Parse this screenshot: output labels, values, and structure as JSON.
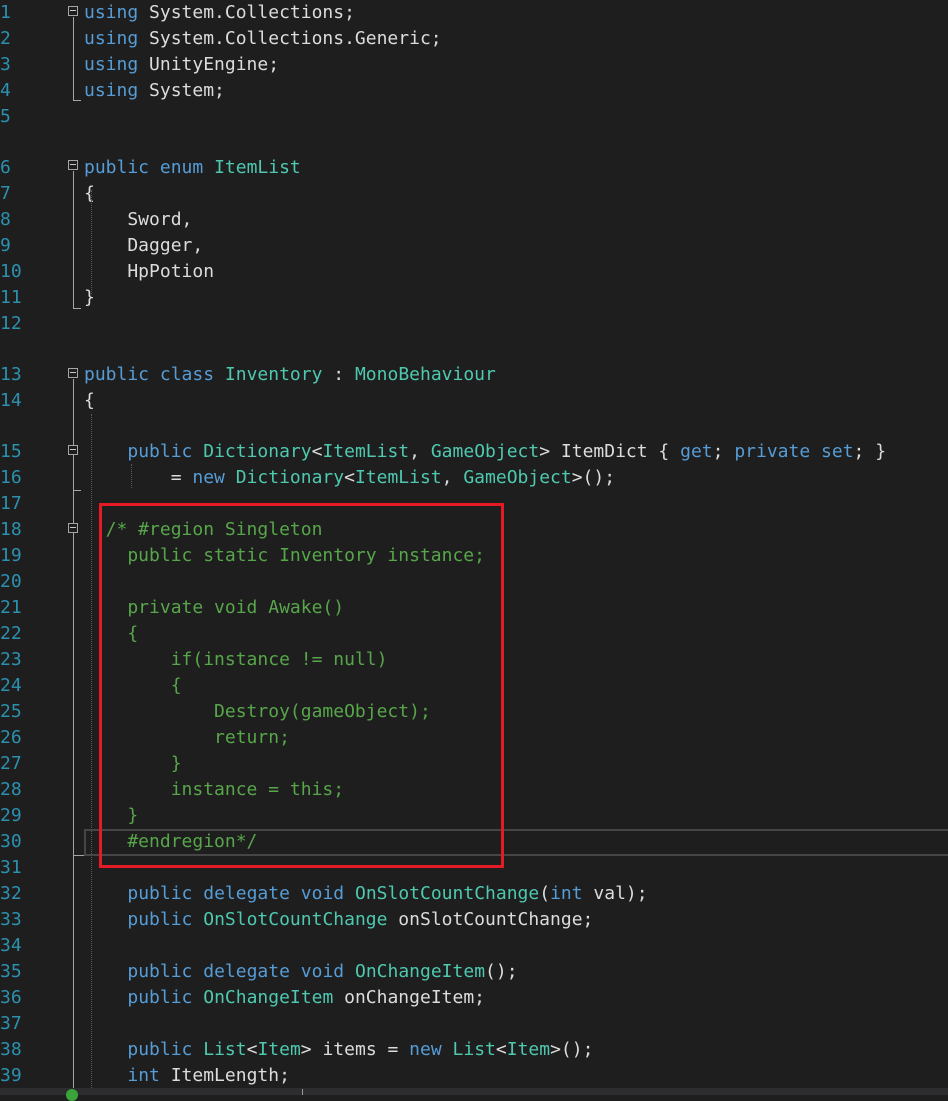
{
  "editor": {
    "line_numbers": [
      "1",
      "2",
      "3",
      "4",
      "5",
      "6",
      "7",
      "8",
      "9",
      "10",
      "11",
      "12",
      "13",
      "14",
      "15",
      "16",
      "17",
      "18",
      "19",
      "20",
      "21",
      "22",
      "23",
      "24",
      "25",
      "26",
      "27",
      "28",
      "29",
      "30",
      "31",
      "32",
      "33",
      "34",
      "35",
      "36",
      "37",
      "38",
      "39"
    ],
    "lines": {
      "l1": [
        {
          "t": "using",
          "c": "kw"
        },
        {
          "t": " System.Collections;",
          "c": "tx"
        }
      ],
      "l2": [
        {
          "t": "using",
          "c": "kw"
        },
        {
          "t": " System.Collections.Generic;",
          "c": "tx"
        }
      ],
      "l3": [
        {
          "t": "using",
          "c": "kw"
        },
        {
          "t": " UnityEngine;",
          "c": "tx"
        }
      ],
      "l4": [
        {
          "t": "using",
          "c": "kw"
        },
        {
          "t": " System;",
          "c": "tx"
        }
      ],
      "l6": [
        {
          "t": "public",
          "c": "kw"
        },
        {
          "t": " ",
          "c": "tx"
        },
        {
          "t": "enum",
          "c": "kw"
        },
        {
          "t": " ",
          "c": "tx"
        },
        {
          "t": "ItemList",
          "c": "ty"
        }
      ],
      "l7": [
        {
          "t": "{",
          "c": "tx"
        }
      ],
      "l8": [
        {
          "t": "    Sword,",
          "c": "tx"
        }
      ],
      "l9": [
        {
          "t": "    Dagger,",
          "c": "tx"
        }
      ],
      "l10": [
        {
          "t": "    HpPotion",
          "c": "tx"
        }
      ],
      "l11": [
        {
          "t": "}",
          "c": "tx"
        }
      ],
      "l13": [
        {
          "t": "public",
          "c": "kw"
        },
        {
          "t": " ",
          "c": "tx"
        },
        {
          "t": "class",
          "c": "kw"
        },
        {
          "t": " ",
          "c": "tx"
        },
        {
          "t": "Inventory",
          "c": "ty"
        },
        {
          "t": " : ",
          "c": "tx"
        },
        {
          "t": "MonoBehaviour",
          "c": "ty"
        }
      ],
      "l14": [
        {
          "t": "{",
          "c": "tx"
        }
      ],
      "l15": [
        {
          "t": "    ",
          "c": "tx"
        },
        {
          "t": "public",
          "c": "kw"
        },
        {
          "t": " ",
          "c": "tx"
        },
        {
          "t": "Dictionary",
          "c": "ty"
        },
        {
          "t": "<",
          "c": "tx"
        },
        {
          "t": "ItemList",
          "c": "ty"
        },
        {
          "t": ", ",
          "c": "tx"
        },
        {
          "t": "GameObject",
          "c": "ty"
        },
        {
          "t": "> ItemDict { ",
          "c": "tx"
        },
        {
          "t": "get",
          "c": "kw"
        },
        {
          "t": "; ",
          "c": "tx"
        },
        {
          "t": "private",
          "c": "kw"
        },
        {
          "t": " ",
          "c": "tx"
        },
        {
          "t": "set",
          "c": "kw"
        },
        {
          "t": "; }",
          "c": "tx"
        }
      ],
      "l16": [
        {
          "t": "        = ",
          "c": "tx"
        },
        {
          "t": "new",
          "c": "kw"
        },
        {
          "t": " ",
          "c": "tx"
        },
        {
          "t": "Dictionary",
          "c": "ty"
        },
        {
          "t": "<",
          "c": "tx"
        },
        {
          "t": "ItemList",
          "c": "ty"
        },
        {
          "t": ", ",
          "c": "tx"
        },
        {
          "t": "GameObject",
          "c": "ty"
        },
        {
          "t": ">();",
          "c": "tx"
        }
      ],
      "l18": [
        {
          "t": "  /* #region Singleton",
          "c": "cm"
        }
      ],
      "l19": [
        {
          "t": "    public static Inventory instance;",
          "c": "cm"
        }
      ],
      "l21": [
        {
          "t": "    private void Awake()",
          "c": "cm"
        }
      ],
      "l22": [
        {
          "t": "    {",
          "c": "cm"
        }
      ],
      "l23": [
        {
          "t": "        if(instance != null)",
          "c": "cm"
        }
      ],
      "l24": [
        {
          "t": "        {",
          "c": "cm"
        }
      ],
      "l25": [
        {
          "t": "            Destroy(gameObject);",
          "c": "cm"
        }
      ],
      "l26": [
        {
          "t": "            return;",
          "c": "cm"
        }
      ],
      "l27": [
        {
          "t": "        }",
          "c": "cm"
        }
      ],
      "l28": [
        {
          "t": "        instance = this;",
          "c": "cm"
        }
      ],
      "l29": [
        {
          "t": "    }",
          "c": "cm"
        }
      ],
      "l30": [
        {
          "t": "    #endregion*/",
          "c": "cm"
        }
      ],
      "l32": [
        {
          "t": "    ",
          "c": "tx"
        },
        {
          "t": "public",
          "c": "kw"
        },
        {
          "t": " ",
          "c": "tx"
        },
        {
          "t": "delegate",
          "c": "kw"
        },
        {
          "t": " ",
          "c": "tx"
        },
        {
          "t": "void",
          "c": "kw"
        },
        {
          "t": " ",
          "c": "tx"
        },
        {
          "t": "OnSlotCountChange",
          "c": "ty"
        },
        {
          "t": "(",
          "c": "tx"
        },
        {
          "t": "int",
          "c": "kw"
        },
        {
          "t": " val);",
          "c": "tx"
        }
      ],
      "l33": [
        {
          "t": "    ",
          "c": "tx"
        },
        {
          "t": "public",
          "c": "kw"
        },
        {
          "t": " ",
          "c": "tx"
        },
        {
          "t": "OnSlotCountChange",
          "c": "ty"
        },
        {
          "t": " onSlotCountChange;",
          "c": "tx"
        }
      ],
      "l35": [
        {
          "t": "    ",
          "c": "tx"
        },
        {
          "t": "public",
          "c": "kw"
        },
        {
          "t": " ",
          "c": "tx"
        },
        {
          "t": "delegate",
          "c": "kw"
        },
        {
          "t": " ",
          "c": "tx"
        },
        {
          "t": "void",
          "c": "kw"
        },
        {
          "t": " ",
          "c": "tx"
        },
        {
          "t": "OnChangeItem",
          "c": "ty"
        },
        {
          "t": "();",
          "c": "tx"
        }
      ],
      "l36": [
        {
          "t": "    ",
          "c": "tx"
        },
        {
          "t": "public",
          "c": "kw"
        },
        {
          "t": " ",
          "c": "tx"
        },
        {
          "t": "OnChangeItem",
          "c": "ty"
        },
        {
          "t": " onChangeItem;",
          "c": "tx"
        }
      ],
      "l38": [
        {
          "t": "    ",
          "c": "tx"
        },
        {
          "t": "public",
          "c": "kw"
        },
        {
          "t": " ",
          "c": "tx"
        },
        {
          "t": "List",
          "c": "ty"
        },
        {
          "t": "<",
          "c": "tx"
        },
        {
          "t": "Item",
          "c": "ty"
        },
        {
          "t": "> items = ",
          "c": "tx"
        },
        {
          "t": "new",
          "c": "kw"
        },
        {
          "t": " ",
          "c": "tx"
        },
        {
          "t": "List",
          "c": "ty"
        },
        {
          "t": "<",
          "c": "tx"
        },
        {
          "t": "Item",
          "c": "ty"
        },
        {
          "t": ">();",
          "c": "tx"
        }
      ],
      "l39": [
        {
          "t": "    ",
          "c": "tx"
        },
        {
          "t": "int",
          "c": "kw"
        },
        {
          "t": " ItemLength;",
          "c": "tx"
        }
      ]
    }
  },
  "colors": {
    "background": "#1e1e1e",
    "keyword": "#569cd6",
    "type": "#4ec9b0",
    "comment": "#57a64a",
    "text": "#dcdcdc",
    "line_number": "#2b91af",
    "highlight_box": "#e51a24"
  }
}
